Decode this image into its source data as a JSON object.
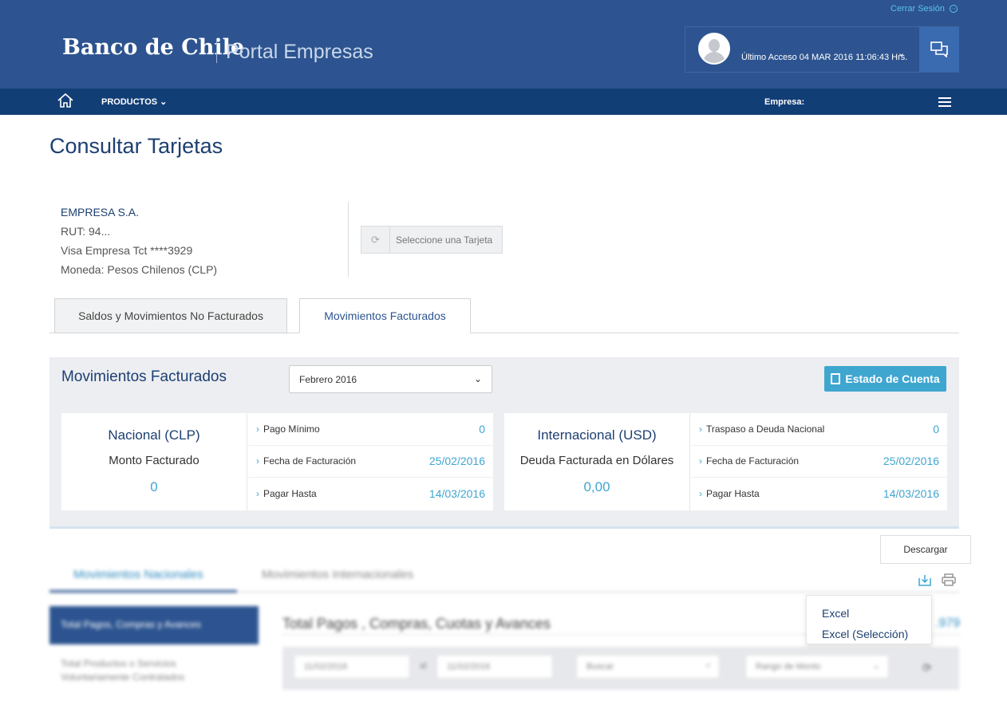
{
  "header": {
    "logo": "Banco de Chile",
    "portal": "Portal Empresas",
    "logout": "Cerrar Sesión",
    "last_access": "Último Acceso 04 MAR 2016 11:06:43 Hrs."
  },
  "nav": {
    "products": "PRODUCTOS",
    "empresa": "Empresa:"
  },
  "page_title": "Consultar Tarjetas",
  "company": {
    "name": "EMPRESA S.A.",
    "rut": "RUT: 94...",
    "card": "Visa Empresa Tct ****3929",
    "currency": "Moneda: Pesos Chilenos (CLP)"
  },
  "card_select": {
    "label": "Seleccione una Tarjeta"
  },
  "tabs": [
    {
      "label": "Saldos y Movimientos No Facturados"
    },
    {
      "label": "Movimientos Facturados"
    }
  ],
  "panel": {
    "title": "Movimientos Facturados",
    "month": "Febrero 2016",
    "estado_btn": "Estado de Cuenta",
    "nacional": {
      "title": "Nacional (CLP)",
      "subtitle": "Monto Facturado",
      "value": "0",
      "rows": [
        {
          "label": "Pago Mínimo",
          "value": "0"
        },
        {
          "label": "Fecha de Facturación",
          "value": "25/02/2016"
        },
        {
          "label": "Pagar Hasta",
          "value": "14/03/2016"
        }
      ]
    },
    "internacional": {
      "title": "Internacional (USD)",
      "subtitle": "Deuda Facturada en Dólares",
      "value": "0,00",
      "rows": [
        {
          "label": "Traspaso a Deuda Nacional",
          "value": "0"
        },
        {
          "label": "Fecha de Facturación",
          "value": "25/02/2016"
        },
        {
          "label": "Pagar Hasta",
          "value": "14/03/2016"
        }
      ]
    }
  },
  "lower": {
    "tab_nacional": "Movimientos Nacionales",
    "tab_internacional": "Movimientos Internacionales",
    "side_active": "Total Pagos, Compras y Avances",
    "side_item": "Total Productos o Servicios Voluntariamente Contratados",
    "content_title": "Total Pagos , Compras, Cuotas y Avances",
    "total_value": ".979",
    "date_from": "11/02/2016",
    "date_sep": "al",
    "date_to": "11/02/2016",
    "search_placeholder": "Buscar",
    "range_placeholder": "Rango de Monto"
  },
  "download": {
    "tooltip": "Descargar",
    "options": [
      "Excel",
      "Excel (Selección)"
    ]
  }
}
